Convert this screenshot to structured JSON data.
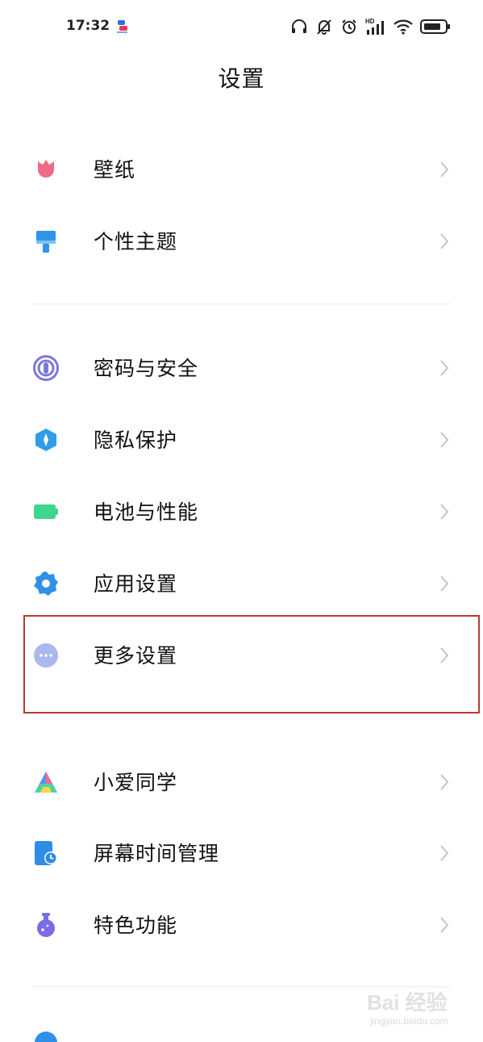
{
  "status_bar": {
    "time": "17:32",
    "hd_label": "HD",
    "icons": [
      "app-notification-icon",
      "headset-icon",
      "bell-muted-icon",
      "alarm-icon",
      "signal-icon",
      "wifi-icon",
      "battery-icon"
    ]
  },
  "header": {
    "title": "设置"
  },
  "items": [
    {
      "id": "wallpaper",
      "label": "壁纸",
      "icon": "tulip-icon",
      "color": "#f06a86"
    },
    {
      "id": "themes",
      "label": "个性主题",
      "icon": "paintbrush-icon",
      "color": "#2f94ea"
    },
    {
      "id": "password-security",
      "label": "密码与安全",
      "icon": "fingerprint-icon",
      "color": "#7b77d8"
    },
    {
      "id": "privacy",
      "label": "隐私保护",
      "icon": "shield-icon",
      "color": "#2f9de8"
    },
    {
      "id": "battery",
      "label": "电池与性能",
      "icon": "battery-icon",
      "color": "#3dd68a"
    },
    {
      "id": "app-settings",
      "label": "应用设置",
      "icon": "gear-icon",
      "color": "#2f90e8"
    },
    {
      "id": "more-settings",
      "label": "更多设置",
      "icon": "more-dots-icon",
      "color": "#a9b8ee"
    },
    {
      "id": "xiaoai",
      "label": "小爱同学",
      "icon": "xiaoai-icon",
      "color": "#5b8ef0"
    },
    {
      "id": "screen-time",
      "label": "屏幕时间管理",
      "icon": "screen-time-icon",
      "color": "#2f8de6"
    },
    {
      "id": "special-features",
      "label": "特色功能",
      "icon": "flask-icon",
      "color": "#7a6ce6"
    }
  ],
  "watermark": {
    "logo": "Bai 经验",
    "url": "jingyan.baidu.com"
  }
}
